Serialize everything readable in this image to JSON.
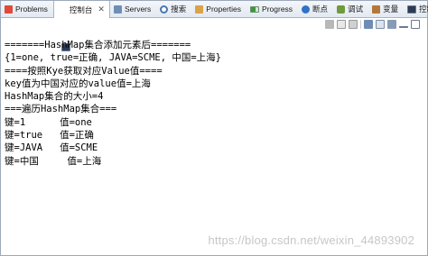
{
  "tabs": [
    {
      "name": "tab-problems",
      "icon": "problems-icon",
      "cls": "problems",
      "label": "Problems",
      "closable": false,
      "active": false
    },
    {
      "name": "tab-console",
      "icon": "console-icon",
      "cls": "console",
      "label": "控制台",
      "closable": true,
      "active": true
    },
    {
      "name": "tab-servers",
      "icon": "servers-icon",
      "cls": "servers",
      "label": "Servers",
      "closable": false,
      "active": false
    },
    {
      "name": "tab-search",
      "icon": "search-icon",
      "cls": "search",
      "label": "搜索",
      "closable": false,
      "active": false
    },
    {
      "name": "tab-properties",
      "icon": "properties-icon",
      "cls": "properties",
      "label": "Properties",
      "closable": false,
      "active": false
    },
    {
      "name": "tab-progress",
      "icon": "progress-icon",
      "cls": "progress",
      "label": "Progress",
      "closable": false,
      "active": false
    },
    {
      "name": "tab-breakpoints",
      "icon": "breakpoints-icon",
      "cls": "breakpoints",
      "label": "断点",
      "closable": false,
      "active": false
    },
    {
      "name": "tab-debug",
      "icon": "debug-icon",
      "cls": "debug",
      "label": "调试",
      "closable": false,
      "active": false
    },
    {
      "name": "tab-variables",
      "icon": "variables-icon",
      "cls": "variables",
      "label": "变量",
      "closable": false,
      "active": false
    },
    {
      "name": "tab-console-2",
      "icon": "console-icon",
      "cls": "console2",
      "label": "控制台",
      "closable": false,
      "active": false
    }
  ],
  "tab_close_glyph": "✕",
  "console": {
    "lines": [
      "=======HashMap集合添加元素后=======",
      "{1=one, true=正确, JAVA=SCME, 中国=上海}",
      "====按照Kye获取对应Value值====",
      "key值为中国对应的value值=上海",
      "HashMap集合的大小=4",
      "===遍历HashMap集合===",
      "键=1      值=one",
      "键=true   值=正确",
      "键=JAVA   值=SCME",
      "键=中国     值=上海"
    ]
  },
  "watermark": "https://blog.csdn.net/weixin_44893902"
}
